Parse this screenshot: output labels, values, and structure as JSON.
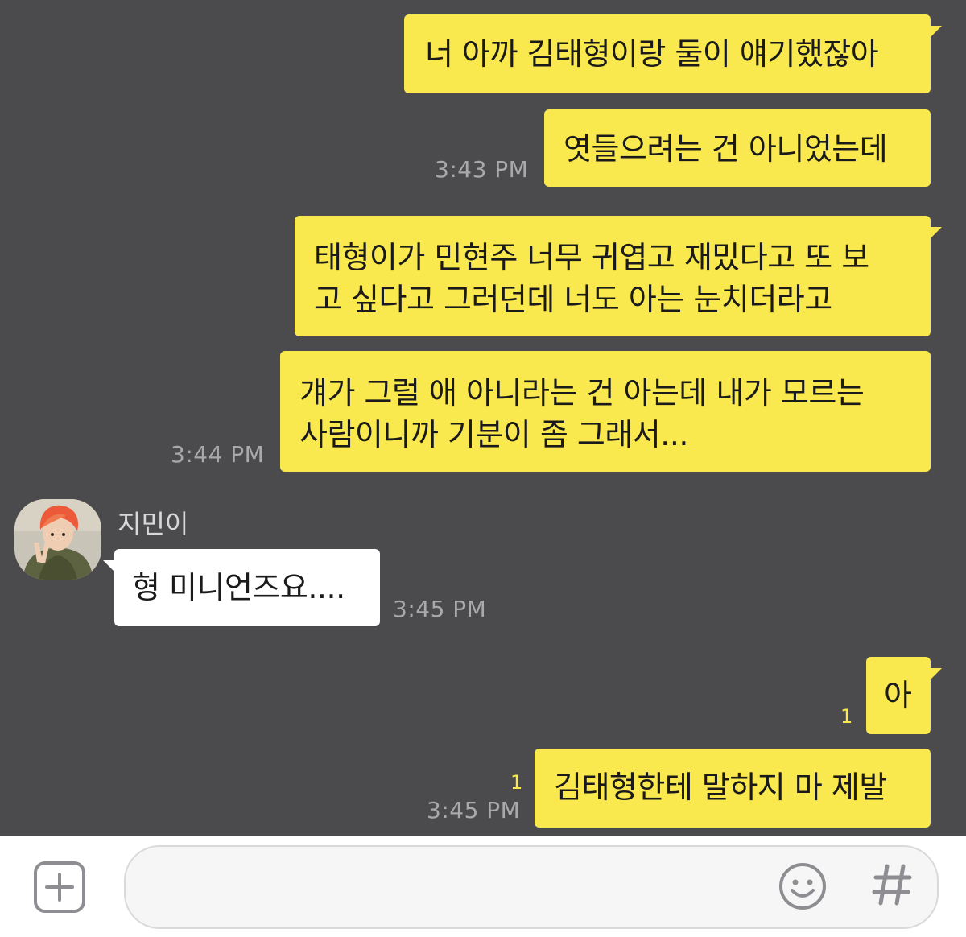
{
  "chat": {
    "messages": [
      {
        "text": "너 아까 김태형이랑 둘이 얘기했잖아"
      },
      {
        "text": "엿들으려는 건 아니었는데",
        "time": "3:43 PM"
      },
      {
        "line1": "태형이가 민현주 너무 귀엽고 재밌다고 또 보",
        "line2": "고 싶다고 그러던데 너도 아는 눈치더라고"
      },
      {
        "line1": "걔가 그럴 애 아니라는 건 아는데 내가 모르는",
        "line2": "사람이니까 기분이 좀 그래서...",
        "time": "3:44 PM"
      },
      {
        "sender": "지민이",
        "text": "형 미니언즈요....",
        "time": "3:45 PM"
      },
      {
        "text": "아",
        "unread": "1"
      },
      {
        "text": "김태형한테 말하지 마 제발",
        "unread": "1",
        "time": "3:45 PM"
      }
    ]
  },
  "composer": {
    "add_icon": "plus-icon",
    "emoji_icon": "emoticon-icon",
    "hash_icon": "hash-icon"
  },
  "colors": {
    "background": "#4b4a4c",
    "my_bubble": "#fae84f",
    "their_bubble": "#ffffff",
    "timestamp": "#a9a8aa"
  }
}
